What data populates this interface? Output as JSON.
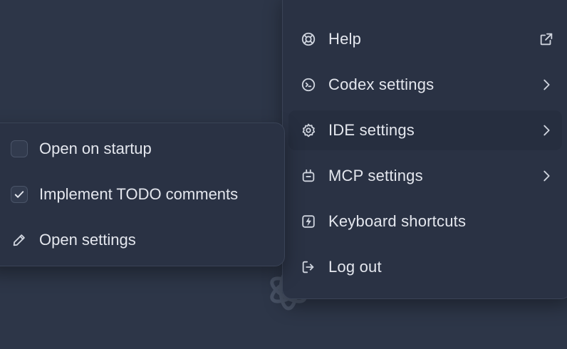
{
  "main_menu": {
    "items": [
      {
        "label": "Help",
        "icon": "lifebuoy-icon",
        "trailing": "external-link-icon"
      },
      {
        "label": "Codex settings",
        "icon": "terminal-icon",
        "trailing": "chevron-right-icon"
      },
      {
        "label": "IDE settings",
        "icon": "gear-icon",
        "trailing": "chevron-right-icon",
        "active": true
      },
      {
        "label": "MCP settings",
        "icon": "plug-icon",
        "trailing": "chevron-right-icon"
      },
      {
        "label": "Keyboard shortcuts",
        "icon": "lightning-key-icon"
      },
      {
        "label": "Log out",
        "icon": "logout-icon"
      }
    ]
  },
  "ide_submenu": {
    "items": [
      {
        "label": "Open on startup",
        "checked": false
      },
      {
        "label": "Implement TODO comments",
        "checked": true
      },
      {
        "label": "Open settings",
        "icon": "pencil-icon"
      }
    ]
  },
  "colors": {
    "background": "#2d3648",
    "menu_surface": "#2a3244",
    "menu_border": "#3a4356",
    "active_item": "#262e3f",
    "text": "#e4e7ee"
  }
}
